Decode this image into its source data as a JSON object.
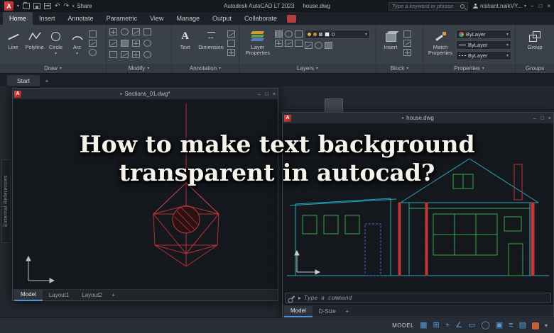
{
  "titlebar": {
    "app_logo": "A",
    "share_label": "Share",
    "app_title": "Autodesk AutoCAD LT 2023",
    "doc_title": "house.dwg",
    "search_placeholder": "Type a keyword or phrase",
    "username": "nishant.naikVY..."
  },
  "ribbon": {
    "tabs": [
      "Home",
      "Insert",
      "Annotate",
      "Parametric",
      "View",
      "Manage",
      "Output",
      "Collaborate"
    ],
    "panels": {
      "draw": {
        "label": "Draw",
        "tools": [
          "Line",
          "Polyline",
          "Circle",
          "Arc"
        ]
      },
      "modify": {
        "label": "Modify"
      },
      "annotation": {
        "label": "Annotation",
        "text_tool": "Text",
        "dimension_tool": "Dimension"
      },
      "layers": {
        "label": "Layers",
        "layer_properties": "Layer Properties",
        "current_layer": "0"
      },
      "block": {
        "label": "Block",
        "insert_tool": "Insert"
      },
      "properties": {
        "label": "Properties",
        "match_properties": "Match Properties",
        "color_value": "ByLayer",
        "linetype_value": "ByLayer",
        "lineweight_value": "ByLayer"
      },
      "groups": {
        "label": "Groups",
        "group_tool": "Group"
      }
    }
  },
  "doc_tabs": {
    "start_label": "Start"
  },
  "external_references_label": "External References",
  "windows": {
    "sections": {
      "title": "Sections_01.dwg*",
      "tabs": [
        "Model",
        "Layout1",
        "Layout2"
      ]
    },
    "house": {
      "title": "house.dwg",
      "command_placeholder": "Type a command",
      "tabs": [
        "Model",
        "D-Size"
      ]
    }
  },
  "overlay": {
    "line1": "How to make text background",
    "line2": "transparent in autocad?"
  },
  "statusbar": {
    "model_label": "MODEL"
  },
  "glyphs": {
    "chevron_down": "▾",
    "caret_right": "▸",
    "minimize": "–",
    "maximize": "□",
    "close": "×",
    "plus": "+",
    "undo": "↶",
    "redo": "↷",
    "text_tool": "A",
    "dimension": "↔",
    "grid": "▦",
    "snap": "⊞",
    "ortho": "∠",
    "polar": "+",
    "osnap": "▭",
    "circle": "◯",
    "iso": "▣",
    "bars": "≡",
    "list": "▤"
  }
}
